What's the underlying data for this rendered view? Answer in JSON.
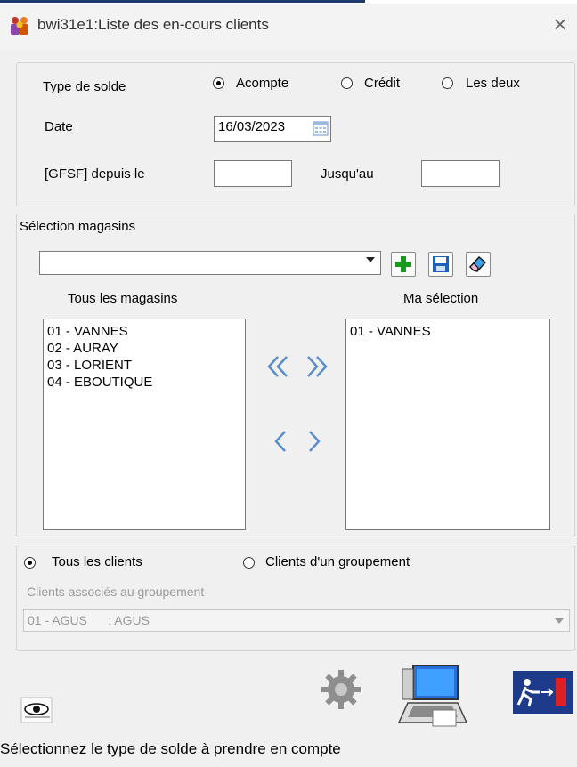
{
  "window": {
    "title": "bwi31e1:Liste des en-cours clients",
    "close": "×"
  },
  "solde": {
    "label": "Type de solde",
    "options": [
      "Acompte",
      "Crédit",
      "Les deux"
    ],
    "selected": "Acompte",
    "date_label": "Date",
    "date_value": "16/03/2023",
    "gfsf_label": "[GFSF] depuis le",
    "gfsf_from": "",
    "jusquau_label": "Jusqu'au",
    "gfsf_to": ""
  },
  "magasins": {
    "group_label": "Sélection magasins",
    "combo_value": "",
    "all_label": "Tous les magasins",
    "all_items": [
      "01 - VANNES",
      "02 - AURAY",
      "03 - LORIENT",
      "04 - EBOUTIQUE"
    ],
    "selection_label": "Ma sélection",
    "selection_items": [
      "01 - VANNES"
    ],
    "move_all_left": "《",
    "move_all_right": "》",
    "move_left": "〈",
    "move_right": "〉"
  },
  "clients": {
    "options": [
      "Tous les clients",
      "Clients d'un groupement"
    ],
    "selected": "Tous les clients",
    "groupement_label": "Clients associés au groupement",
    "groupement_value": "01 - AGUS      : AGUS"
  },
  "status_bar": {
    "text": "Sélectionnez le type de solde à prendre en compte"
  },
  "icons": [
    "app-people-icon",
    "close-icon",
    "calendar-icon",
    "add-icon",
    "save-icon",
    "eraser-icon",
    "eye-preview-icon",
    "gear-icon",
    "computer-print-icon",
    "exit-icon"
  ],
  "colors": {
    "add_green": "#1a9a1a",
    "save_blue": "#1f5fbf",
    "exit_blue": "#1e3a8a",
    "exit_red": "#e02020"
  }
}
